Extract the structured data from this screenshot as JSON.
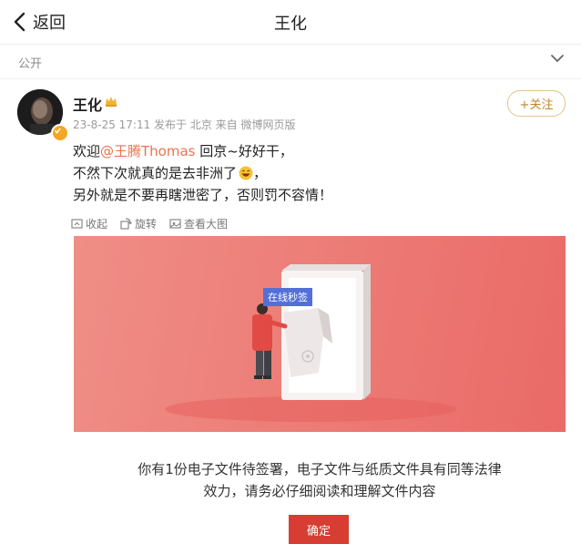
{
  "nav": {
    "back_label": "返回",
    "title": "王化"
  },
  "visibility": "公开",
  "post": {
    "author": "王化",
    "meta": "23-8-25 17:11 发布于 北京 来自 微博网页版",
    "follow_label": "+关注",
    "line1_prefix": "欢迎",
    "mention": "@王腾Thomas",
    "line1_suffix": " 回京~好好干，",
    "line2": "不然下次就真的是去非洲了",
    "line2_end": "，",
    "line3": "另外就是不要再瞎泄密了，否则罚不容情！"
  },
  "image_tools": [
    {
      "icon": "collapse-icon",
      "label": "收起"
    },
    {
      "icon": "rotate-icon",
      "label": "旋转"
    },
    {
      "icon": "view-large-icon",
      "label": "查看大图"
    }
  ],
  "card": {
    "tag": "在线秒签",
    "text_line1": "你有1份电子文件待签署，电子文件与纸质文件具有同等法律",
    "text_line2": "效力，请务必仔细阅读和理解文件内容",
    "confirm_label": "确定"
  },
  "colors": {
    "mention": "#eb7350",
    "follow_text": "#c2852c",
    "confirm_bg": "#d73d32",
    "hero_bg": "#ea6a67",
    "tag_bg": "#5470d6"
  }
}
